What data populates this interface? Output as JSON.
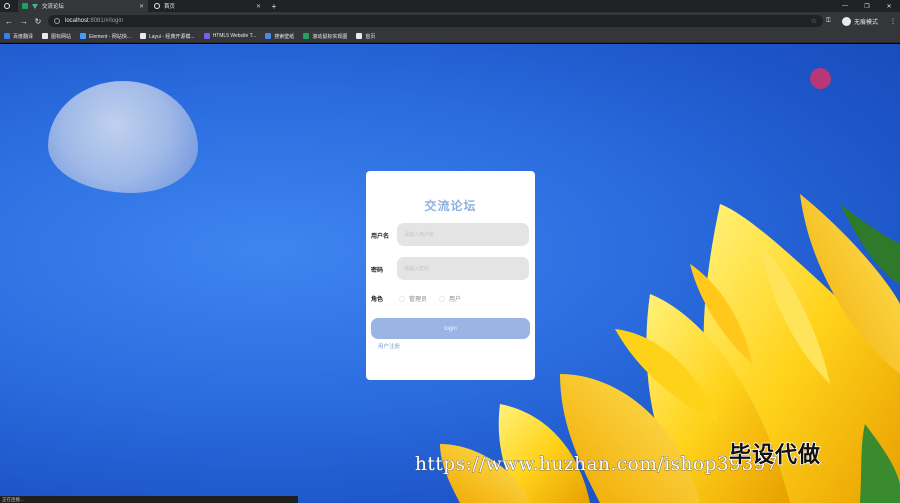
{
  "browser": {
    "tabs": [
      {
        "label": "交流论坛",
        "icon": "vue-icon",
        "active": true
      },
      {
        "label": "首页",
        "icon": "globe-icon",
        "active": false
      }
    ],
    "new_tab": "+",
    "address": {
      "host": "localhost",
      "rest": ":8081/#/login"
    },
    "incognito_label": "无痕模式",
    "bookmarks": [
      {
        "label": "百度翻译",
        "icon": "translate-icon",
        "color": "#3b7cf0"
      },
      {
        "label": "图标网站",
        "icon": "flag-icon",
        "color": "#e8eaed"
      },
      {
        "label": "Element - 网站快...",
        "icon": "element-icon",
        "color": "#409eff"
      },
      {
        "label": "Layui - 经典开源模...",
        "icon": "layui-icon",
        "color": "#e8eaed"
      },
      {
        "label": "HTML5 Website T...",
        "icon": "html5-icon",
        "color": "#7a5cf0"
      },
      {
        "label": "搜索壁纸",
        "icon": "wallpaper-icon",
        "color": "#4b86e8"
      },
      {
        "label": "滚动鼠标实现图",
        "icon": "green-square-icon",
        "color": "#1ea362"
      },
      {
        "label": "首页",
        "icon": "globe-icon",
        "color": "#e8eaed"
      }
    ]
  },
  "login": {
    "title": "交流论坛",
    "username_label": "用户名",
    "username_placeholder": "请输入用户名",
    "password_label": "密码",
    "password_placeholder": "请输入密码",
    "role_label": "角色",
    "roles": [
      "管理员",
      "用户"
    ],
    "login_button": "login",
    "register_link": "用户注册"
  },
  "watermark": {
    "title": "毕设代做",
    "url": "https://www.huzhan.com/ishop39397"
  },
  "status_text": "正在连接..."
}
